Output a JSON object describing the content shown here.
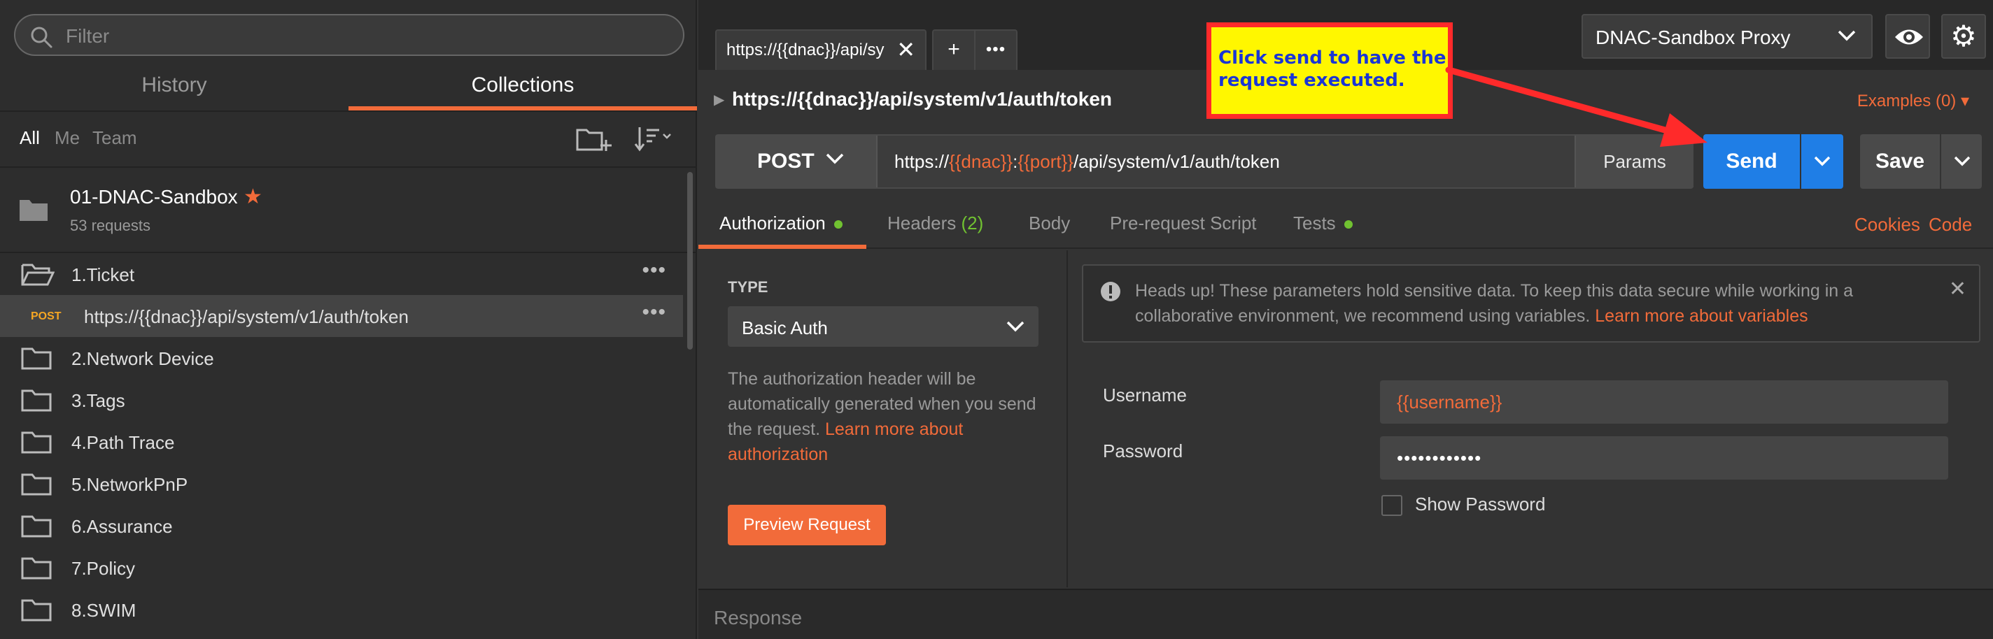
{
  "sidebar": {
    "filter_placeholder": "Filter",
    "tabs": [
      "History",
      "Collections"
    ],
    "filter_options": [
      "All",
      "Me",
      "Team"
    ],
    "collection": {
      "name": "01-DNAC-Sandbox",
      "count": "53 requests",
      "starred": true
    },
    "tree": [
      {
        "type": "folder",
        "label": "1.Ticket"
      },
      {
        "type": "request",
        "method": "POST",
        "label": "https://{{dnac}}/api/system/v1/auth/token"
      },
      {
        "type": "folder",
        "label": "2.Network Device"
      },
      {
        "type": "folder",
        "label": "3.Tags"
      },
      {
        "type": "folder",
        "label": "4.Path Trace"
      },
      {
        "type": "folder",
        "label": "5.NetworkPnP"
      },
      {
        "type": "folder",
        "label": "6.Assurance"
      },
      {
        "type": "folder",
        "label": "7.Policy"
      },
      {
        "type": "folder",
        "label": "8.SWIM"
      }
    ]
  },
  "tabs": {
    "active_title": "https://{{dnac}}/api/sy",
    "close_glyph": "✕",
    "plus_glyph": "+",
    "more_glyph": "•••"
  },
  "environment": {
    "selected": "DNAC-Sandbox Proxy"
  },
  "request": {
    "title": "https://{{dnac}}/api/system/v1/auth/token",
    "examples": "Examples (0) ▾",
    "method": "POST",
    "url_parts": {
      "prefix": "https://",
      "var1": "{{dnac}}",
      "colon": ":",
      "var2": "{{port}}",
      "path": "/api/system/v1/auth/token"
    },
    "params_label": "Params",
    "send_label": "Send",
    "save_label": "Save"
  },
  "subtabs": {
    "authorization": "Authorization",
    "headers": "Headers",
    "headers_count": "(2)",
    "body": "Body",
    "prerequest": "Pre-request Script",
    "tests": "Tests",
    "cookies": "Cookies",
    "code": "Code"
  },
  "auth": {
    "type_label": "TYPE",
    "type_value": "Basic Auth",
    "desc": "The authorization header will be automatically generated when you send the request. ",
    "desc_link": "Learn more about authorization",
    "preview_label": "Preview Request",
    "notice": "Heads up! These parameters hold sensitive data. To keep this data secure while working in a collaborative environment, we recommend using variables. ",
    "notice_link": "Learn more about variables",
    "username_label": "Username",
    "username_value": "{{username}}",
    "password_label": "Password",
    "password_value": "••••••••••••",
    "show_password": "Show Password"
  },
  "response": {
    "label": "Response"
  },
  "annotation": {
    "text": "Click send to have the request executed."
  },
  "colors": {
    "accent": "#f26b3a",
    "send_blue": "#1f7ee6",
    "status_green": "#71c231",
    "callout_yellow": "#fff700",
    "callout_red": "#ff2a2a",
    "callout_text": "#1a35d6"
  }
}
